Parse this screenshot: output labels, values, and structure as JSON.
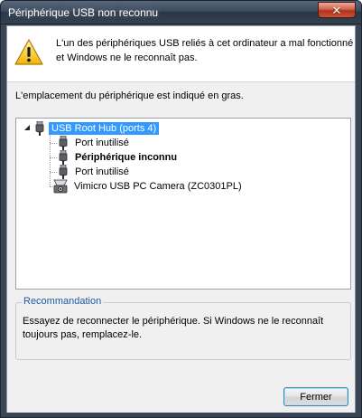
{
  "window": {
    "title": "Périphérique USB non reconnu",
    "close_glyph": "✕"
  },
  "header": {
    "message": "L'un des périphériques USB reliés à cet ordinateur a mal fonctionné et Windows ne le reconnaît pas.",
    "icon": "warning-icon"
  },
  "main": {
    "location_label": "L'emplacement du périphérique est indiqué en gras.",
    "tree": [
      {
        "label": "USB Root Hub (ports 4)",
        "icon": "usb-plug-icon",
        "selected": true,
        "bold": false,
        "level": 0
      },
      {
        "label": "Port inutilisé",
        "icon": "usb-plug-icon",
        "selected": false,
        "bold": false,
        "level": 1
      },
      {
        "label": "Périphérique inconnu",
        "icon": "usb-plug-icon",
        "selected": false,
        "bold": true,
        "level": 1
      },
      {
        "label": "Port inutilisé",
        "icon": "usb-plug-icon",
        "selected": false,
        "bold": false,
        "level": 1
      },
      {
        "label": "Vimicro USB PC Camera (ZC0301PL)",
        "icon": "camera-icon",
        "selected": false,
        "bold": false,
        "level": 1
      }
    ],
    "recommendation": {
      "title": "Recommandation",
      "body": "Essayez de reconnecter le périphérique. Si Windows ne le reconnaît toujours pas, remplacez-le."
    }
  },
  "buttons": {
    "close_label": "Fermer"
  },
  "colors": {
    "selection": "#3399ff",
    "group_title": "#1e5aa0",
    "title_bar": "#3b4a5c"
  }
}
